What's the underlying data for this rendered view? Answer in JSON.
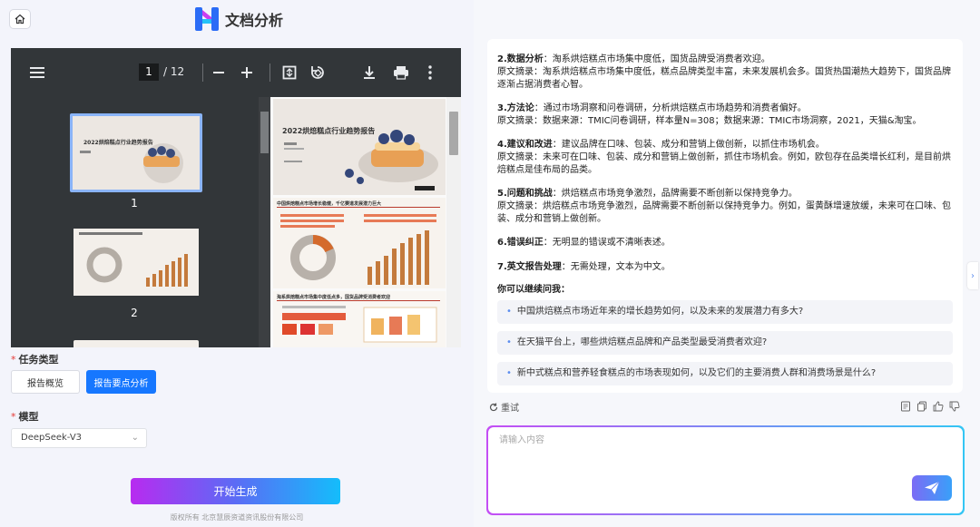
{
  "header": {
    "title": "文档分析"
  },
  "viewer": {
    "page_current": "1",
    "page_total": "/ 12",
    "thumbnails": [
      {
        "label": "1",
        "title": "2022烘焙糕点行业趋势报告"
      },
      {
        "label": "2"
      }
    ],
    "page1_title": "2022烘焙糕点行业趋势报告",
    "page2_title": "中国烘焙糕点市场增长稳健，千亿赛道发展潜力巨大",
    "page3_title": "淘系烘焙糕点市场集中度低点多，国货品牌受消费者欢迎"
  },
  "form": {
    "task_label": "任务类型",
    "task_options": [
      "报告概览",
      "报告要点分析"
    ],
    "model_label": "模型",
    "model_value": "DeepSeek-V3",
    "generate_label": "开始生成",
    "footer": "版权所有 北京慧辰资道资讯股份有限公司"
  },
  "answer": {
    "sections": [
      {
        "head": "2.数据分析",
        "text": "：淘系烘焙糕点市场集中度低，国货品牌受消费者欢迎。",
        "quote": "原文摘录：淘系烘焙糕点市场集中度低，糕点品牌类型丰富，未来发展机会多。国货热国潮热大趋势下，国货品牌逐渐占据消费者心智。"
      },
      {
        "head": "3.方法论",
        "text": "：通过市场洞察和问卷调研，分析烘焙糕点市场趋势和消费者偏好。",
        "quote": "原文摘录：数据来源：TMIC问卷调研，样本量N=308；数据来源：TMIC市场洞察，2021，天猫&淘宝。"
      },
      {
        "head": "4.建议和改进",
        "text": "：建议品牌在口味、包装、成分和营销上做创新，以抓住市场机会。",
        "quote": "原文摘录：未来可在口味、包装、成分和营销上做创新，抓住市场机会。例如，欧包存在品类增长红利，是目前烘焙糕点是佳布局的品类。"
      },
      {
        "head": "5.问题和挑战",
        "text": "：烘焙糕点市场竞争激烈，品牌需要不断创新以保持竞争力。",
        "quote": "原文摘录：烘焙糕点市场竞争激烈，品牌需要不断创新以保持竞争力。例如，蛋黄酥增速放缓，未来可在口味、包装、成分和营销上做创新。"
      },
      {
        "head": "6.错误纠正",
        "text": "：无明显的错误或不清晰表述。",
        "quote": ""
      },
      {
        "head": "7.英文报告处理",
        "text": "：无需处理，文本为中文。",
        "quote": ""
      }
    ],
    "followup_title": "你可以继续问我：",
    "suggestions": [
      "中国烘焙糕点市场近年来的增长趋势如何，以及未来的发展潜力有多大?",
      "在天猫平台上，哪些烘焙糕点品牌和产品类型最受消费者欢迎?",
      "新中式糕点和营养轻食糕点的市场表现如何，以及它们的主要消费人群和消费场景是什么?"
    ],
    "retry_label": "重试"
  },
  "input": {
    "placeholder": "请输入内容"
  },
  "colors": {
    "accent": "#1677ff",
    "viewer_bg": "#323639",
    "gradient_start": "#b82bf0",
    "gradient_end": "#14bdfb"
  }
}
